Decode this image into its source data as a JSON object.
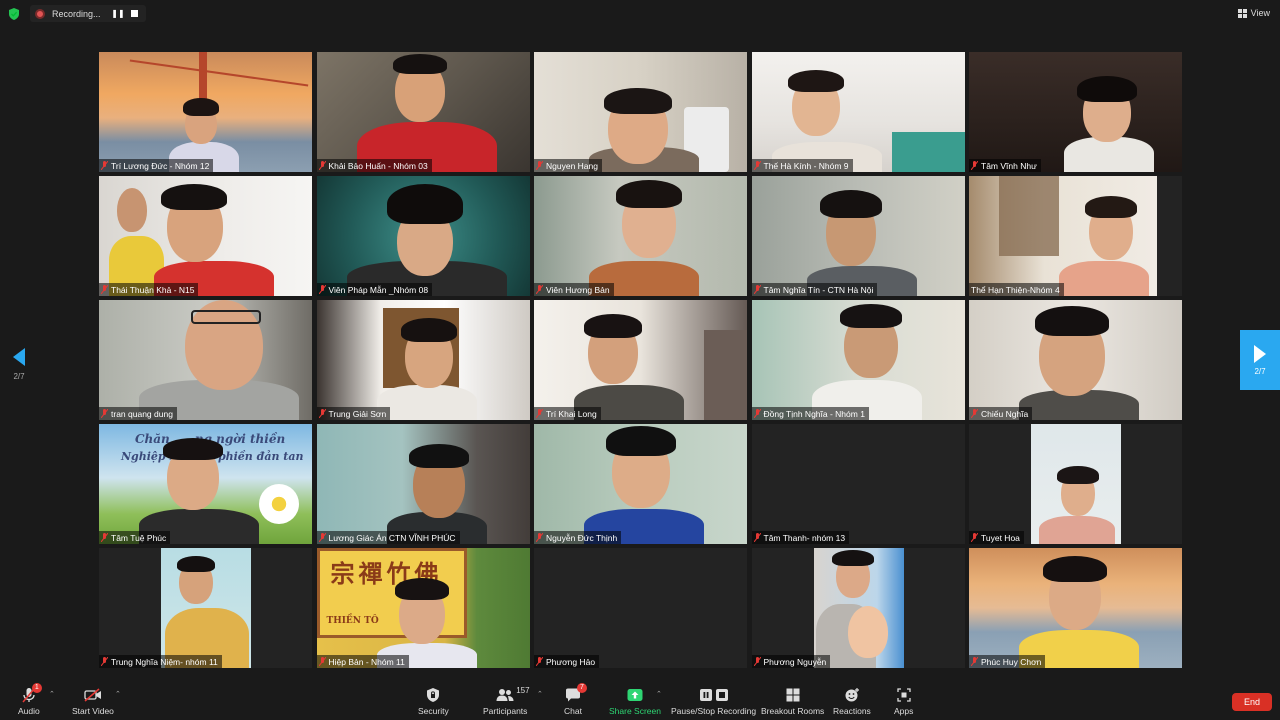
{
  "recording": {
    "text": "Recording...",
    "pause_icon": "pause-icon",
    "stop_icon": "stop-icon"
  },
  "view": {
    "label": "View"
  },
  "pagination": {
    "current": "2/7"
  },
  "participants": [
    {
      "name": "Trí Lương Đức - Nhóm 12"
    },
    {
      "name": "Khải Bảo Huấn - Nhóm 03"
    },
    {
      "name": "Nguyen Hang"
    },
    {
      "name": "Thế Hà Kính - Nhóm 9"
    },
    {
      "name": "Tâm Vĩnh Như"
    },
    {
      "name": "Thái Thuận Khả - N15"
    },
    {
      "name": "Viên Pháp Mẫn _Nhóm 08"
    },
    {
      "name": "Viên Hương Bản"
    },
    {
      "name": "Tâm Nghĩa Tín - CTN Hà Nội"
    },
    {
      "name": "Thể Hạn Thiện-Nhóm 4"
    },
    {
      "name": "tran quang dung"
    },
    {
      "name": "Trung Giải Sơn"
    },
    {
      "name": "Trí Khai Long"
    },
    {
      "name": "Đồng Tịnh Nghĩa - Nhóm 1"
    },
    {
      "name": "Chiếu Nghĩa"
    },
    {
      "name": "Tâm Tuệ Phúc"
    },
    {
      "name": "Lương Giác Án CTN VĨNH PHÚC"
    },
    {
      "name": "Nguyễn Đức Thịnh"
    },
    {
      "name": "Tâm Thanh- nhóm 13"
    },
    {
      "name": "Tuyet Hoa"
    },
    {
      "name": "Trung Nghĩa Niệm- nhóm 11"
    },
    {
      "name": "Hiệp Bản - Nhóm 11"
    },
    {
      "name": "Phương Hảo"
    },
    {
      "name": "Phương Nguyễn"
    },
    {
      "name": "Phúc Huy Chơn"
    }
  ],
  "tile_background_text": {
    "banner_line1": "Chăn      ng ngời thiền",
    "banner_line2": "Nghiệp xa       i phiền đản tan",
    "sign_top": "宗禪竹佛",
    "sign_bottom": "THIỀN TÔ          ANG"
  },
  "toolbar": {
    "audio": {
      "label": "Audio",
      "badge": "1"
    },
    "video": {
      "label": "Start Video"
    },
    "security": {
      "label": "Security"
    },
    "participants": {
      "label": "Participants",
      "count": "157"
    },
    "chat": {
      "label": "Chat",
      "badge": "7"
    },
    "share": {
      "label": "Share Screen"
    },
    "record": {
      "label": "Pause/Stop Recording"
    },
    "breakout": {
      "label": "Breakout Rooms"
    },
    "reactions": {
      "label": "Reactions"
    },
    "apps": {
      "label": "Apps"
    },
    "end": {
      "label": "End"
    }
  },
  "colors": {
    "accent": "#2aa8f0",
    "end": "#d93025",
    "share": "#2ed573",
    "mute": "#e53935"
  }
}
